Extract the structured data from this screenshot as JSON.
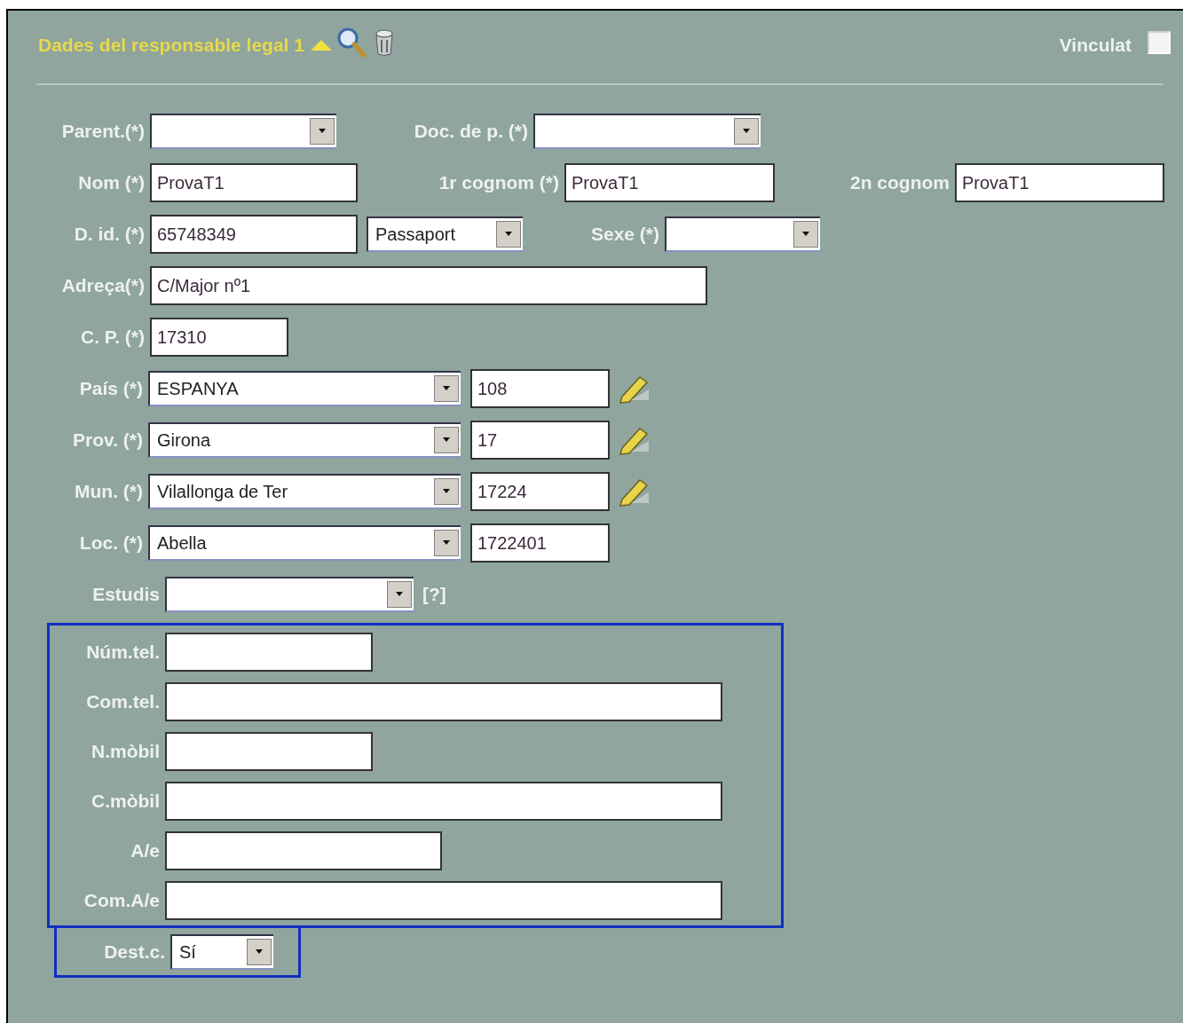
{
  "section": {
    "title": "Dades del responsable legal 1",
    "expanded": true
  },
  "vinculat": {
    "label": "Vinculat",
    "checked": false
  },
  "rows": [
    [
      {
        "kind": "select",
        "label": "Parent.(*)"
      },
      {
        "kind": "select",
        "label": "Doc. de p. (*)"
      }
    ],
    [
      {
        "kind": "text",
        "label": "Nom (*)",
        "value": "ProvaT1"
      },
      {
        "kind": "text",
        "label": "1r cognom (*)",
        "value": "ProvaT1"
      },
      {
        "kind": "text",
        "label": "2n cognom",
        "value": "ProvaT1"
      }
    ],
    [
      {
        "kind": "text",
        "label": "D. id. (*)",
        "value": "65748349"
      },
      {
        "kind": "select",
        "value": "Passaport"
      },
      {
        "kind": "select",
        "label": "Sexe (*)"
      }
    ],
    [
      {
        "kind": "text",
        "label": "Adreça(*)",
        "value": "C/Major nº1"
      }
    ],
    [
      {
        "kind": "text",
        "label": "C. P. (*)",
        "value": "17310"
      }
    ],
    [
      {
        "kind": "select",
        "label": "País (*)",
        "value": "ESPANYA"
      },
      {
        "kind": "text",
        "value": "108",
        "editable": true
      }
    ],
    [
      {
        "kind": "select",
        "label": "Prov. (*)",
        "value": "Girona"
      },
      {
        "kind": "text",
        "value": "17",
        "editable": true
      }
    ],
    [
      {
        "kind": "select",
        "label": "Mun. (*)",
        "value": "Vilallonga de Ter"
      },
      {
        "kind": "text",
        "value": "17224",
        "editable": true
      }
    ],
    [
      {
        "kind": "select",
        "label": "Loc. (*)",
        "value": "Abella"
      },
      {
        "kind": "text",
        "value": "1722401",
        "editable": false
      }
    ],
    [
      {
        "kind": "select",
        "label": "Estudis",
        "help": "[?]"
      }
    ]
  ],
  "contact": [
    {
      "label": "Núm.tel."
    },
    {
      "label": "Com.tel."
    },
    {
      "label": "N.mòbil"
    },
    {
      "label": "C.mòbil"
    },
    {
      "label": "A/e"
    },
    {
      "label": "Com.A/e"
    }
  ],
  "dest": {
    "label": "Dest.c.",
    "value": "Sí"
  }
}
